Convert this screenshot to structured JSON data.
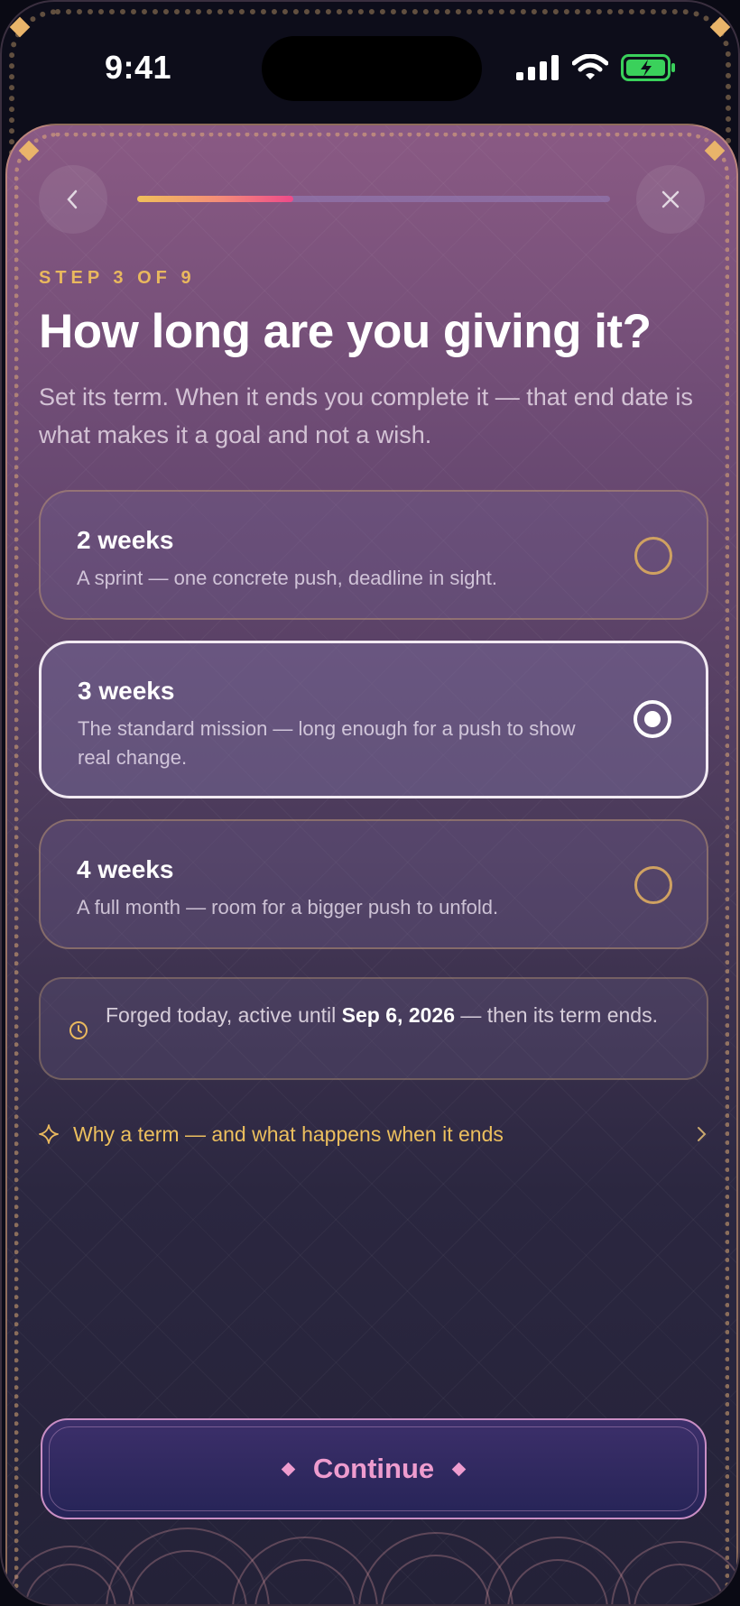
{
  "status_bar": {
    "time": "9:41"
  },
  "header": {
    "back_icon": "chevron-left-icon",
    "close_icon": "close-icon",
    "progress_fraction": 0.33
  },
  "step_label": "STEP 3 OF 9",
  "title": "How long are you giving it?",
  "subtitle": "Set its term. When it ends you complete it — that end date is what makes it a goal and not a wish.",
  "options": [
    {
      "title": "2 weeks",
      "description": "A sprint — one concrete push, deadline in sight.",
      "selected": false
    },
    {
      "title": "3 weeks",
      "description": "The standard mission — long enough for a push to show real change.",
      "selected": true
    },
    {
      "title": "4 weeks",
      "description": "A full month — room for a bigger push to unfold.",
      "selected": false
    }
  ],
  "info": {
    "icon": "clock-icon",
    "text_before": "Forged today, active until ",
    "date": "Sep 6, 2026",
    "text_after": " — then its term ends."
  },
  "why_link": {
    "icon": "sparkle-icon",
    "label": "Why a term — and what happens when it ends",
    "chevron": "chevron-right-icon"
  },
  "continue_button": {
    "label": "Continue"
  },
  "colors": {
    "accent_gold": "#e9b85e",
    "accent_pink": "#ee9cce",
    "battery_green": "#3ad15b"
  }
}
